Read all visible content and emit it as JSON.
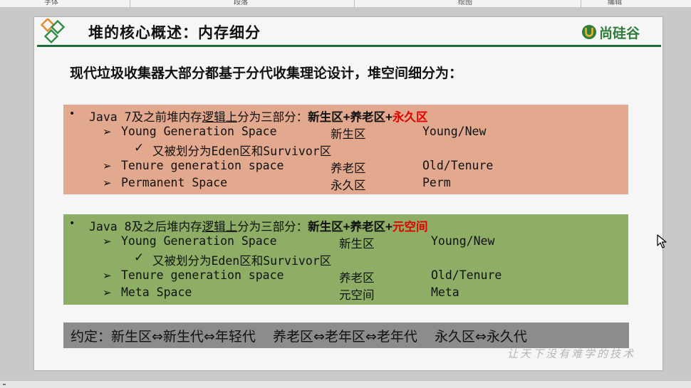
{
  "toolbar": {
    "groups": [
      "字体",
      "段落",
      "绘图",
      "编辑"
    ]
  },
  "slide": {
    "title": "堆的核心概述：内存细分",
    "brand": "尚硅谷",
    "subtitle": "现代垃圾收集器大部分都基于分代收集理论设计，堆空间细分为：",
    "java7": {
      "prefix": "Java 7及之前堆内存",
      "logic": "逻辑上",
      "mid": "分为三部分：",
      "young_old": "新生区+养老区+",
      "highlight": "永久区",
      "rows": [
        {
          "name": "Young Generation Space",
          "cn": "新生区",
          "en": "Young/New"
        },
        {
          "name": "Tenure generation space",
          "cn": "养老区",
          "en": "Old/Tenure"
        },
        {
          "name": "Permanent Space",
          "cn": "永久区",
          "en": "Perm"
        }
      ],
      "sub_prefix": "又被划分为",
      "sub_eden": "Eden",
      "sub_and": "区和",
      "sub_surv": "Survivor",
      "sub_end": "区"
    },
    "java8": {
      "prefix": "Java 8及之后堆内存",
      "logic": "逻辑上",
      "mid": "分为三部分：",
      "young_old": "新生区+养老区+",
      "highlight": "元空间",
      "rows": [
        {
          "name": "Young Generation Space",
          "cn": "新生区",
          "en": "Young/New"
        },
        {
          "name": "Tenure generation space",
          "cn": "养老区",
          "en": "Old/Tenure"
        },
        {
          "name": "Meta Space",
          "cn": "元空间",
          "en": "Meta"
        }
      ],
      "sub_prefix": "又被划分为",
      "sub_eden": "Eden",
      "sub_and": "区和",
      "sub_surv": "Survivor",
      "sub_end": "区"
    },
    "convention": "约定：新生区⇔新生代⇔年轻代    养老区⇔老年区⇔老年代    永久区⇔永久代",
    "watermark": "让天下没有难学的技术"
  },
  "colors": {
    "accent_green": "#1f6b3a",
    "box_salmon": "#e2a98f",
    "box_green": "#8eae66",
    "convention_gray": "#8c8c8c",
    "highlight_red": "#e00000"
  }
}
